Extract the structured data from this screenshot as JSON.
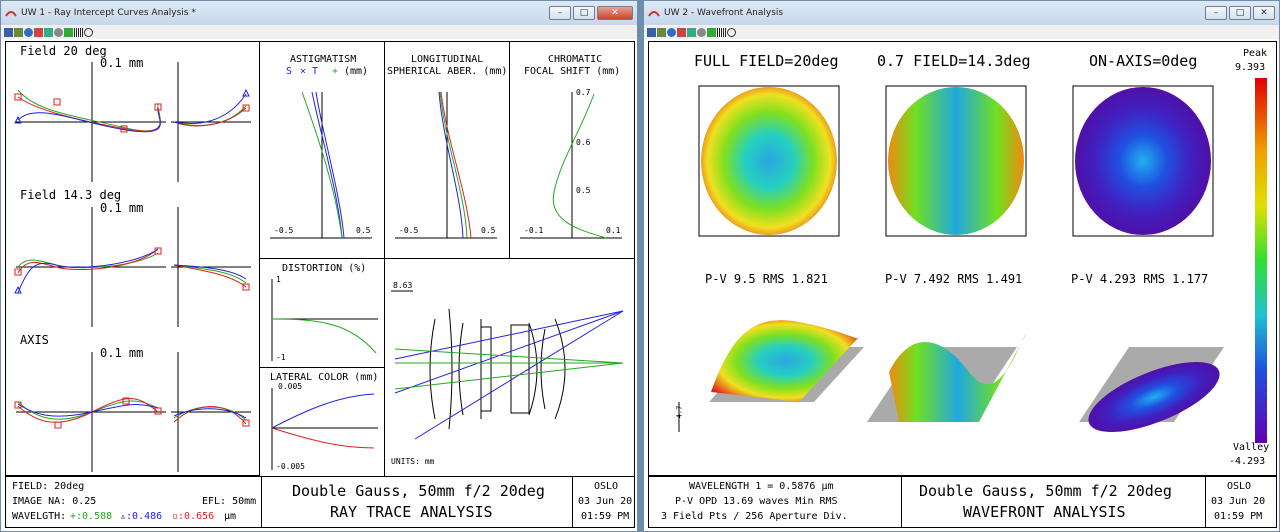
{
  "left_window": {
    "title": "UW 1 - Ray Intercept Curves Analysis *",
    "fan_groups": [
      {
        "label": "Field 20 deg",
        "scale": "0.1 mm"
      },
      {
        "label": "Field 14.3 deg",
        "scale": "0.1 mm"
      },
      {
        "label": "AXIS",
        "scale": "0.1 mm"
      }
    ],
    "astig": {
      "title1": "ASTIGMATISM",
      "legend_s": "S",
      "legend_t": "× T",
      "legend_plus": "+",
      "unit": "(mm)",
      "tick_min": "-0.5",
      "tick_max": "0.5"
    },
    "longit": {
      "title1": "LONGITUDINAL",
      "title2": "SPHERICAL ABER. (mm)",
      "tick_min": "-0.5",
      "tick_max": "0.5"
    },
    "chrom": {
      "title1": "CHROMATIC",
      "title2": "FOCAL SHIFT (mm)",
      "y1": "0.7",
      "y2": "0.6",
      "y3": "0.5",
      "tick_min": "-0.1",
      "tick_max": "0.1"
    },
    "distortion": {
      "title": "DISTORTION (%)",
      "top": "1",
      "bottom": "-1"
    },
    "lateral": {
      "title": "LATERAL COLOR (mm)",
      "top": "0.005",
      "bottom": "-0.005"
    },
    "lens": {
      "scale": "8.63",
      "units": "UNITS: mm"
    },
    "footer": {
      "field": "FIELD: 20deg",
      "image_na": "IMAGE NA: 0.25",
      "efl": "EFL: 50mm",
      "wavelength_label": "WAVELGTH:",
      "wl1": "+:0.588",
      "wl2": "▵:0.486",
      "wl3": "▫:0.656",
      "wl_unit": "µm",
      "title": "Double Gauss, 50mm f/2 20deg",
      "subtitle": "RAY TRACE ANALYSIS",
      "brand": "OSLO",
      "date": "03 Jun 20",
      "time": "01:59 PM"
    }
  },
  "right_window": {
    "title": "UW 2 - Wavefront Analysis",
    "col_titles": [
      "FULL FIELD=20deg",
      "0.7 FIELD=14.3deg",
      "ON-AXIS=0deg"
    ],
    "stats": [
      "P-V 9.5 RMS 1.821",
      "P-V 7.492 RMS 1.491",
      "P-V 4.293 RMS 1.177"
    ],
    "peak_label": "Peak",
    "peak_value": "9.393",
    "valley_label": "Valley",
    "valley_value": "-4.293",
    "axis_tick": "4.7",
    "footer": {
      "line1": "WAVELENGTH 1 = 0.5876 µm",
      "line2": "P-V OPD 13.69 waves Min RMS",
      "line3": "3 Field Pts / 256 Aperture Div.",
      "title": "Double Gauss, 50mm f/2 20deg",
      "subtitle": "WAVEFRONT ANALYSIS",
      "brand": "OSLO",
      "date": "03 Jun 20",
      "time": "01:59 PM"
    }
  },
  "colors": {
    "green": "#22aa22",
    "blue": "#2222dd",
    "red": "#dd2222"
  }
}
